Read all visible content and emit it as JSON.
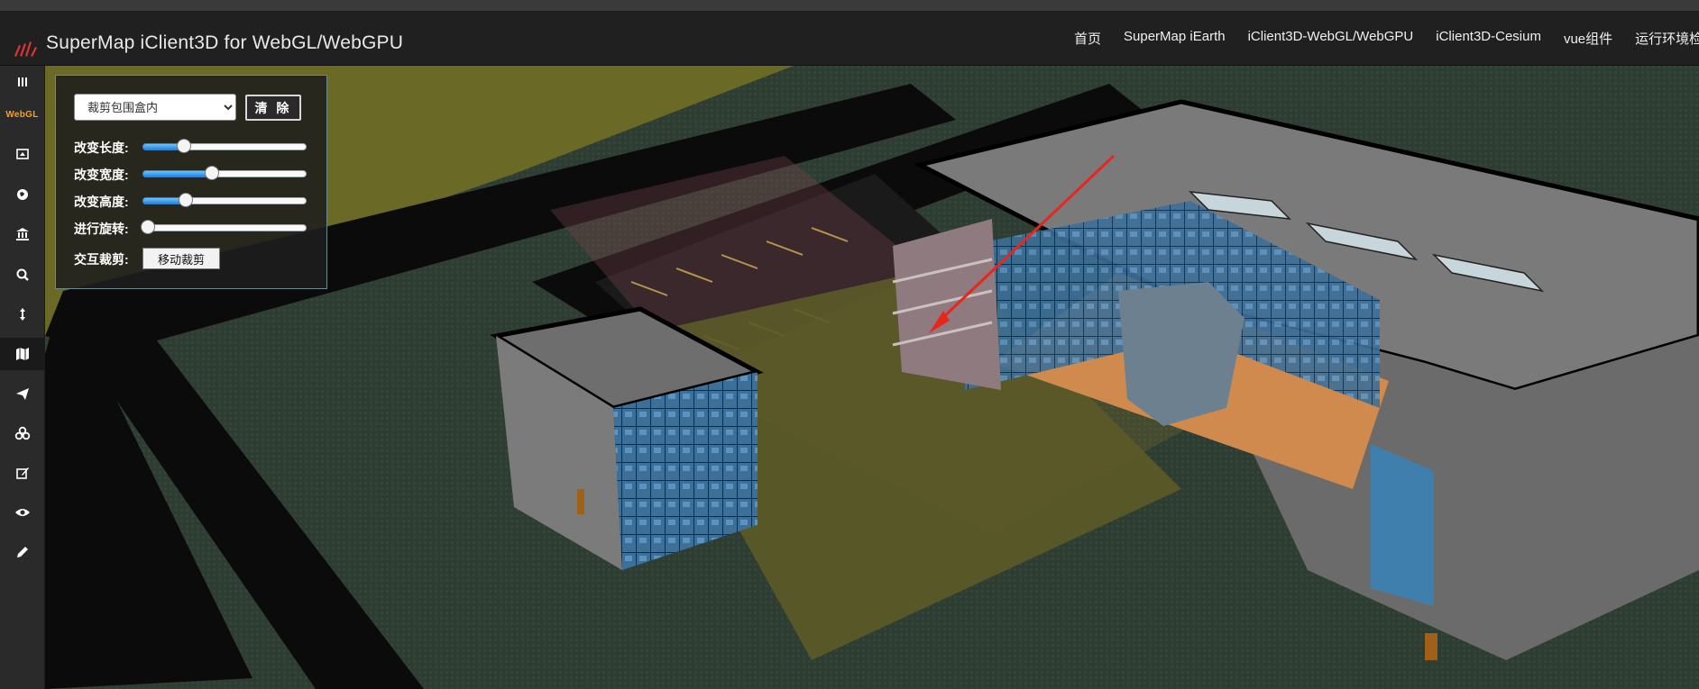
{
  "header": {
    "title": "SuperMap iClient3D for WebGL/WebGPU",
    "nav": [
      "首页",
      "SuperMap iEarth",
      "iClient3D-WebGL/WebGPU",
      "iClient3D-Cesium",
      "vue组件",
      "运行环境检测"
    ]
  },
  "sidebar": {
    "webgl_tag": "WebGL",
    "icons": [
      "menu-icon",
      "webgl-badge",
      "scene-icon",
      "globe-icon",
      "building-icon",
      "search-icon",
      "height-icon",
      "map-icon",
      "send-icon",
      "layers-icon",
      "edit-icon",
      "eye-icon",
      "pencil-icon"
    ],
    "active_index": 7
  },
  "panel": {
    "mode_select_value": "裁剪包围盒内",
    "clear_label": "清 除",
    "length_label": "改变长度:",
    "width_label": "改变宽度:",
    "height_label": "改变高度:",
    "rotate_label": "进行旋转:",
    "interactive_label": "交互裁剪:",
    "move_label": "移动裁剪",
    "sliders": {
      "length": 0.25,
      "width": 0.42,
      "height": 0.26,
      "rotate": 0.03
    }
  },
  "colors": {
    "accent_orange": "#f4a028",
    "arrow_red": "#e8261e",
    "clip_box_yellow": "#6f6a1e",
    "ground": "#2b3a2e"
  }
}
